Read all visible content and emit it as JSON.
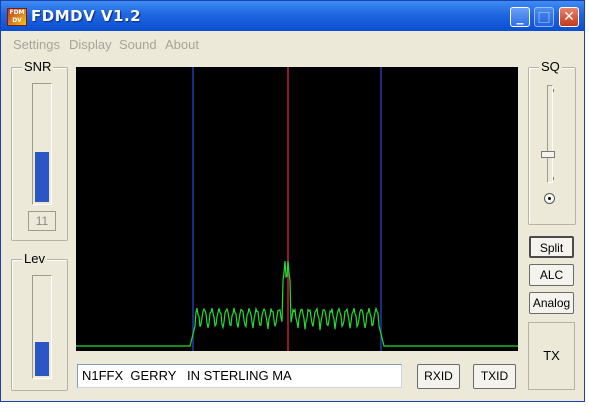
{
  "window": {
    "title": "FDMDV   V1.2",
    "app_icon_text": "FDM DV",
    "controls": {
      "minimize": "_",
      "maximize": "□",
      "close": "✕"
    }
  },
  "menu": [
    "Settings",
    "Display",
    "Sound",
    "About"
  ],
  "snr": {
    "label": "SNR",
    "level_fraction": 0.43,
    "value": "11"
  },
  "lev": {
    "label": "Lev",
    "level_fraction": 0.35
  },
  "sq": {
    "label": "SQ",
    "slider_fraction": 0.73
  },
  "mode_buttons": {
    "split": "Split",
    "alc": "ALC",
    "analog": "Analog"
  },
  "tx_button": "TX",
  "text_field_value": "N1FFX  GERRY   IN STERLING MA",
  "rxid_button": "RXID",
  "txid_button": "TXID",
  "colors": {
    "spectrum_background": "#000000",
    "spectrum_trace": "#22dd33",
    "center_marker": "#c0203a",
    "band_marker": "#2438b0",
    "meter_fill": "#2b56c6"
  }
}
